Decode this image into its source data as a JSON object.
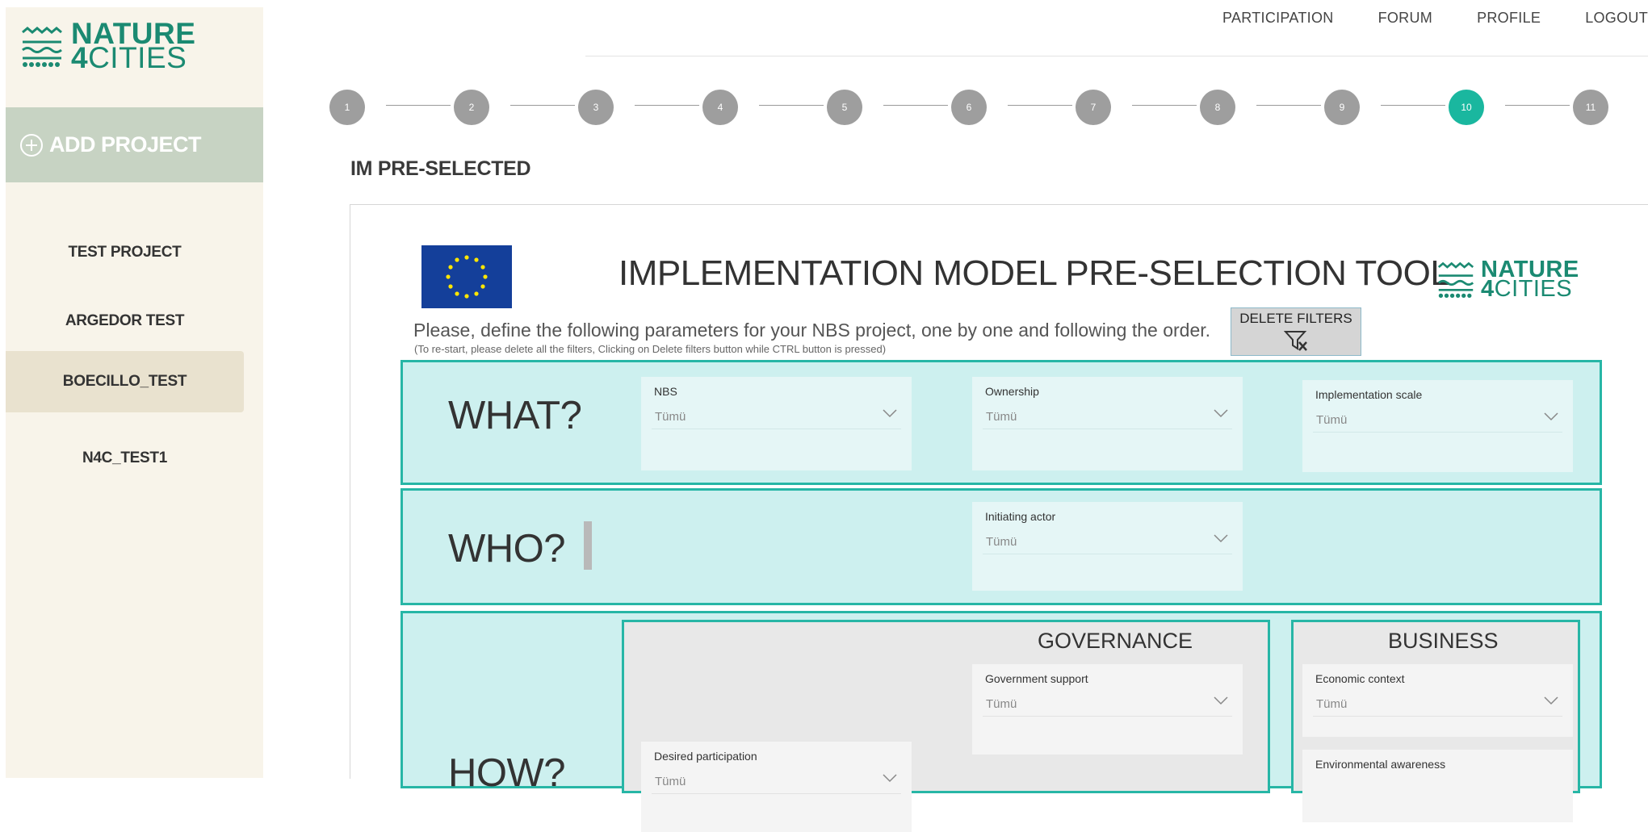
{
  "brand": {
    "line1": "NATURE",
    "line2_num": "4",
    "line2_text": "CITIES"
  },
  "sidebar": {
    "add_project": "ADD PROJECT",
    "projects": [
      "TEST PROJECT",
      "ARGEDOR TEST",
      "BOECILLO_TEST",
      "N4C_TEST1"
    ],
    "active_project": "BOECILLO_TEST"
  },
  "nav": {
    "items": [
      "PARTICIPATION",
      "FORUM",
      "PROFILE",
      "LOGOUT"
    ]
  },
  "stepper": {
    "steps": [
      "1",
      "2",
      "3",
      "4",
      "5",
      "6",
      "7",
      "8",
      "9",
      "10",
      "11"
    ],
    "active": "10"
  },
  "page": {
    "title": "IM PRE-SELECTED"
  },
  "report": {
    "title": "IMPLEMENTATION MODEL PRE-SELECTION TOOL",
    "instruction": "Please, define the following parameters for your NBS project, one by one and following the order.",
    "instruction_note": "(To re-start, please delete all the filters, Clicking on Delete filters button while CTRL button is pressed)",
    "delete_filters": "DELETE FILTERS",
    "sections": {
      "what": "WHAT?",
      "who": "WHO?",
      "how": "HOW?",
      "governance": "GOVERNANCE",
      "business": "BUSINESS"
    },
    "slicers": {
      "nbs": {
        "label": "NBS",
        "value": "Tümü"
      },
      "ownership": {
        "label": "Ownership",
        "value": "Tümü"
      },
      "implementation_scale": {
        "label": "Implementation scale",
        "value": "Tümü"
      },
      "initiating_actor": {
        "label": "Initiating actor",
        "value": "Tümü"
      },
      "government_support": {
        "label": "Government support",
        "value": "Tümü"
      },
      "economic_context": {
        "label": "Economic context",
        "value": "Tümü"
      },
      "desired_participation": {
        "label": "Desired participation",
        "value": "Tümü"
      },
      "environmental_awareness": {
        "label": "Environmental awareness",
        "value": ""
      }
    }
  },
  "colors": {
    "brand_green": "#1b8a72",
    "accent_teal": "#1ab79f",
    "band_fill": "#cdf0ef",
    "band_border": "#27b6a6",
    "sidebar_bg": "#f8f4ea",
    "add_project_bg": "#c7d3c3"
  }
}
